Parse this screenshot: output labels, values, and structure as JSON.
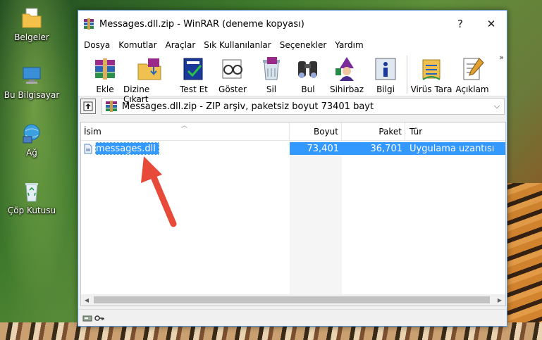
{
  "desktop": {
    "icons": [
      {
        "label": "Belgeler",
        "icon": "folder-icon"
      },
      {
        "label": "Bu Bilgisayar",
        "icon": "computer-icon"
      },
      {
        "label": "Ağ",
        "icon": "network-icon"
      },
      {
        "label": "Çöp Kutusu",
        "icon": "recycle-bin-icon"
      }
    ]
  },
  "window": {
    "title": "Messages.dll.zip - WinRAR (deneme kopyası)",
    "help_btn": "?",
    "close_btn": "✕"
  },
  "menu": {
    "items": [
      "Dosya",
      "Komutlar",
      "Araçlar",
      "Sık Kullanılanlar",
      "Seçenekler",
      "Yardım"
    ]
  },
  "toolbar": {
    "buttons": [
      {
        "label": "Ekle",
        "icon": "add-archive-icon"
      },
      {
        "label": "Dizine Çıkart",
        "icon": "extract-to-icon"
      },
      {
        "label": "Test Et",
        "icon": "test-icon"
      },
      {
        "label": "Göster",
        "icon": "view-icon"
      },
      {
        "label": "Sil",
        "icon": "delete-icon"
      },
      {
        "label": "Bul",
        "icon": "find-icon"
      },
      {
        "label": "Sihirbaz",
        "icon": "wizard-icon"
      },
      {
        "label": "Bilgi",
        "icon": "info-icon"
      },
      {
        "label": "Virüs Tara",
        "icon": "virus-scan-icon"
      },
      {
        "label": "Açıklam",
        "icon": "comment-icon"
      }
    ],
    "more": "»"
  },
  "address": {
    "text": "Messages.dll.zip - ZIP arşiv, paketsiz boyut 73401 bayt",
    "dropdown": "⌵"
  },
  "filelist": {
    "columns": {
      "name": "İsim",
      "size": "Boyut",
      "packed": "Paket",
      "type": "Tür"
    },
    "rows": [
      {
        "name": "messages.dll",
        "size": "73,401",
        "packed": "36,701",
        "type": "Uygulama uzantısı"
      }
    ]
  },
  "colors": {
    "selection": "#3399ff",
    "accent_border": "#5a8fcf",
    "arrow": "#e84a3a"
  }
}
